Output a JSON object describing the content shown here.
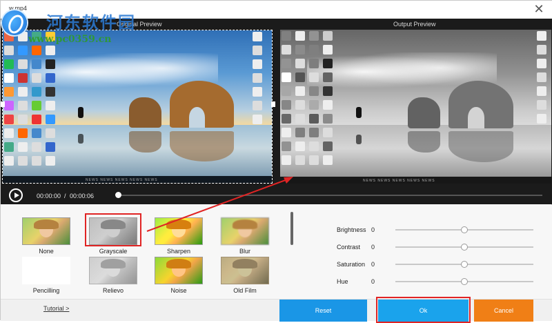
{
  "window": {
    "title": "w.mp4",
    "close_icon": "close-icon"
  },
  "watermark": {
    "site_name": "河东软件园",
    "url": "www.pc0359.cn"
  },
  "preview": {
    "original_label": "Original Preview",
    "output_label": "Output Preview",
    "taskbar_text": "NEWS  NEWS  NEWS  NEWS  NEWS"
  },
  "player": {
    "current_time": "00:00:00",
    "separator": "/",
    "total_time": "00:00:06",
    "progress": 0
  },
  "filters": [
    {
      "label": "None"
    },
    {
      "label": "Grayscale",
      "selected": true
    },
    {
      "label": "Sharpen"
    },
    {
      "label": "Blur"
    },
    {
      "label": "Pencilling"
    },
    {
      "label": "Relievo"
    },
    {
      "label": "Noise"
    },
    {
      "label": "Old Film"
    }
  ],
  "adjustments": [
    {
      "label": "Brightness",
      "value": "0"
    },
    {
      "label": "Contrast",
      "value": "0"
    },
    {
      "label": "Saturation",
      "value": "0"
    },
    {
      "label": "Hue",
      "value": "0"
    }
  ],
  "footer": {
    "tutorial_link": "Tutorial >",
    "reset_label": "Reset",
    "ok_label": "Ok",
    "cancel_label": "Cancel"
  },
  "colors": {
    "reset_button": "#1a96e6",
    "ok_button": "#1aa3ec",
    "cancel_button": "#f07f16",
    "highlight": "#e02424",
    "preview_background": "#1b1b1b"
  }
}
